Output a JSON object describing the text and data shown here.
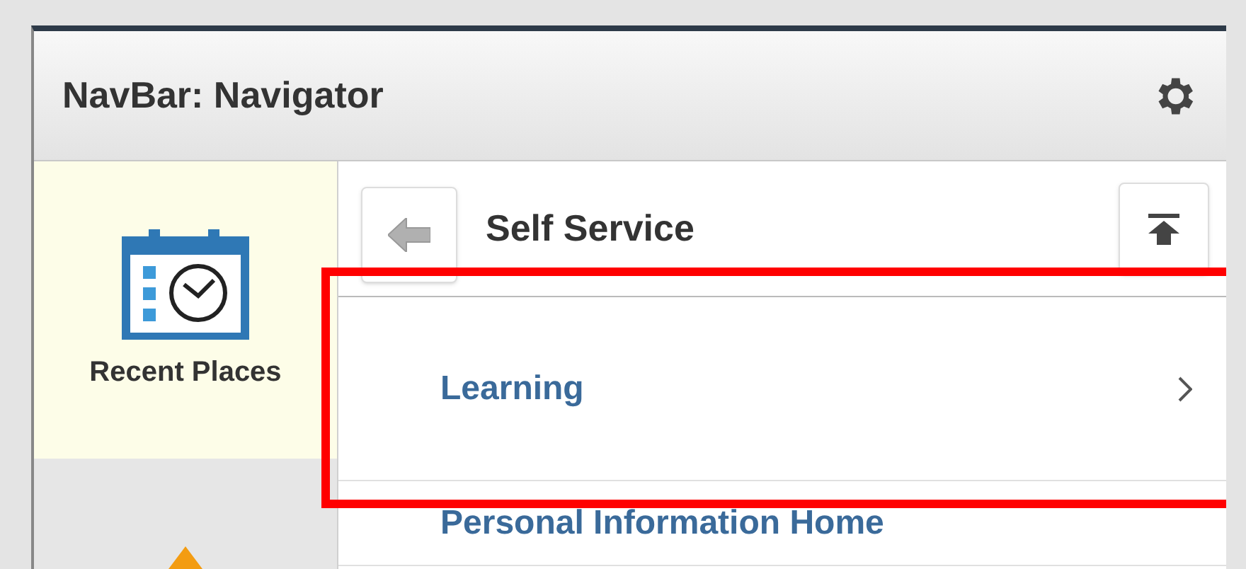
{
  "window": {
    "title": "NavBar: Navigator"
  },
  "sidebar": {
    "items": [
      {
        "label": "Recent Places",
        "kind": "recent",
        "selected": true
      },
      {
        "kind": "favorites",
        "selected": false
      }
    ]
  },
  "panel": {
    "title": "Self Service",
    "items": [
      {
        "label": "Learning",
        "highlighted": true,
        "has_children": true
      },
      {
        "label": "Personal Information Home",
        "highlighted": false,
        "has_children": false
      }
    ]
  }
}
